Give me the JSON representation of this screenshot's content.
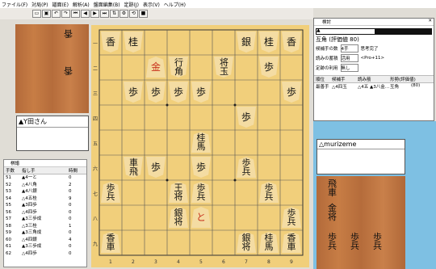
{
  "menu": [
    "ファイル(F)",
    "対局(P)",
    "譜面(E)",
    "解析(A)",
    "盤面編集(B)",
    "定跡(J)",
    "表示(V)",
    "ヘルプ(H)"
  ],
  "toolbar_icons": [
    "open",
    "save",
    "undo",
    "redo",
    "first",
    "prev",
    "next",
    "last",
    "flip",
    "settings",
    "reverse",
    "stop"
  ],
  "board": {
    "file_labels": [
      "1",
      "2",
      "3",
      "4",
      "5",
      "6",
      "7",
      "8",
      "9"
    ],
    "rank_labels": [
      "九",
      "八",
      "七",
      "六",
      "五",
      "四",
      "三",
      "二",
      "一"
    ],
    "gote_pieces_left": [
      "香",
      "桂",
      "銀",
      "金",
      "王"
    ],
    "pieces": [
      {
        "label": "香",
        "side": "w",
        "col": 0,
        "row": 0
      },
      {
        "label": "桂",
        "side": "w",
        "col": 1,
        "row": 0
      },
      {
        "label": "銀",
        "side": "w",
        "col": 6,
        "row": 0
      },
      {
        "label": "桂",
        "side": "w",
        "col": 7,
        "row": 0
      },
      {
        "label": "香",
        "side": "w",
        "col": 8,
        "row": 0
      },
      {
        "label": "金",
        "side": "b",
        "col": 2,
        "row": 1,
        "red": true
      },
      {
        "label": "角行",
        "side": "w",
        "col": 3,
        "row": 1
      },
      {
        "label": "玉将",
        "side": "w",
        "col": 5,
        "row": 1
      },
      {
        "label": "歩",
        "side": "w",
        "col": 7,
        "row": 1
      },
      {
        "label": "歩",
        "side": "w",
        "col": 1,
        "row": 2
      },
      {
        "label": "歩",
        "side": "w",
        "col": 2,
        "row": 2
      },
      {
        "label": "歩",
        "side": "w",
        "col": 3,
        "row": 2
      },
      {
        "label": "歩",
        "side": "w",
        "col": 4,
        "row": 2
      },
      {
        "label": "歩",
        "side": "w",
        "col": 8,
        "row": 2
      },
      {
        "label": "歩",
        "side": "w",
        "col": 6,
        "row": 3
      },
      {
        "label": "桂馬",
        "side": "b",
        "col": 4,
        "row": 4
      },
      {
        "label": "飛車",
        "side": "w",
        "col": 1,
        "row": 5
      },
      {
        "label": "歩",
        "side": "w",
        "col": 2,
        "row": 5
      },
      {
        "label": "歩",
        "side": "w",
        "col": 4,
        "row": 5
      },
      {
        "label": "歩兵",
        "side": "b",
        "col": 6,
        "row": 5
      },
      {
        "label": "歩兵",
        "side": "b",
        "col": 0,
        "row": 6
      },
      {
        "label": "王将",
        "side": "b",
        "col": 3,
        "row": 6
      },
      {
        "label": "歩兵",
        "side": "b",
        "col": 4,
        "row": 6
      },
      {
        "label": "歩兵",
        "side": "b",
        "col": 7,
        "row": 6
      },
      {
        "label": "銀将",
        "side": "b",
        "col": 3,
        "row": 7
      },
      {
        "label": "と",
        "side": "b",
        "col": 4,
        "row": 7,
        "red": true
      },
      {
        "label": "歩兵",
        "side": "b",
        "col": 8,
        "row": 7
      },
      {
        "label": "香車",
        "side": "b",
        "col": 0,
        "row": 8
      },
      {
        "label": "銀将",
        "side": "b",
        "col": 6,
        "row": 8
      },
      {
        "label": "桂馬",
        "side": "b",
        "col": 7,
        "row": 8
      },
      {
        "label": "香車",
        "side": "b",
        "col": 8,
        "row": 8
      }
    ]
  },
  "gote_hand": [
    "香",
    "香"
  ],
  "sente_hand": [
    "飛車",
    "金将",
    "歩兵",
    "歩兵",
    "歩兵"
  ],
  "sente_player": "▲Y田さん",
  "gote_player": "△murizeme",
  "kifu_window": {
    "title": "棋譜",
    "headers": [
      "手数",
      "指し手",
      "時間"
    ],
    "moves": [
      {
        "n": "51",
        "move": "▲4一と",
        "t": "0"
      },
      {
        "n": "52",
        "move": "△4八角",
        "t": "2"
      },
      {
        "n": "53",
        "move": "▲4八銀",
        "t": "0"
      },
      {
        "n": "54",
        "move": "△4五桂",
        "t": "9"
      },
      {
        "n": "55",
        "move": "▲3四歩",
        "t": "0"
      },
      {
        "n": "56",
        "move": "△4四歩",
        "t": "0"
      },
      {
        "n": "57",
        "move": "▲3三歩成",
        "t": "0"
      },
      {
        "n": "58",
        "move": "△3三桂",
        "t": "1"
      },
      {
        "n": "59",
        "move": "▲3三角成",
        "t": "0"
      },
      {
        "n": "60",
        "move": "△4四銀",
        "t": "4"
      },
      {
        "n": "61",
        "move": "▲3三歩成",
        "t": "0"
      },
      {
        "n": "62",
        "move": "△4四歩",
        "t": "0"
      }
    ]
  },
  "analysis": {
    "title": "検討",
    "eval_label": "互角 (評価値 80)",
    "candidates_label": "候補手の数",
    "candidates_value": "4手",
    "thinking_done": "思考完了",
    "reading_label": "読みの蓄積",
    "reading_value": "活用",
    "joseki_label": "定跡の利用",
    "joseki_value": "無し",
    "engine": "<Pro+11>",
    "headers": [
      "順位",
      "候補手",
      "読み筋",
      "形勢(評価値)"
    ],
    "row": {
      "rank": "最善手",
      "move": "△4四玉",
      "line": "△4五 ▲3八金…",
      "eval": "互角",
      "value": "(80)"
    }
  },
  "colors": {
    "board": "#f1cf7b",
    "stand": "#c27a45",
    "desk": "#7ec0e3",
    "red": "#c8321c"
  }
}
